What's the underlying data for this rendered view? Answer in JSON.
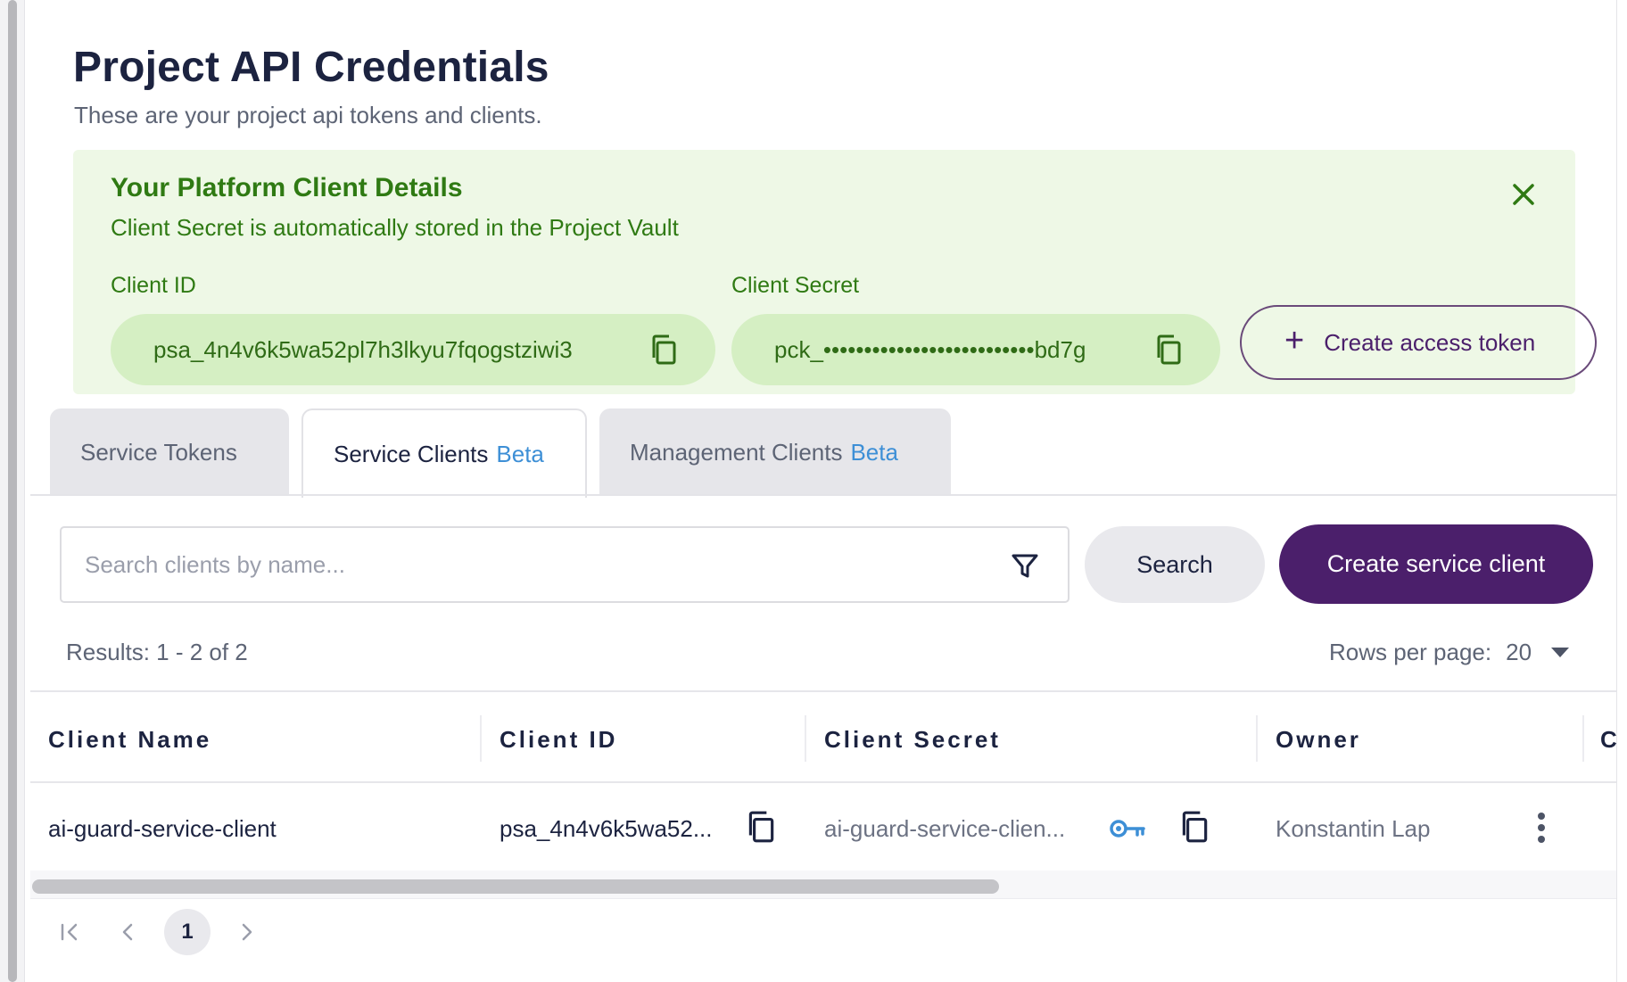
{
  "page": {
    "title": "Project API Credentials",
    "subtitle": "These are your project api tokens and clients."
  },
  "banner": {
    "title": "Your Platform Client Details",
    "subtitle": "Client Secret is automatically stored in the Project Vault",
    "client_id_label": "Client ID",
    "client_id_value": "psa_4n4v6k5wa52pl7h3lkyu7fqogstziwi3",
    "client_secret_label": "Client Secret",
    "client_secret_value": "pck_••••••••••••••••••••••••••bd7g",
    "create_token_label": "Create access token",
    "accent_color": "#2f7a13",
    "background_color": "#eef8e6"
  },
  "tabs": [
    {
      "label": "Service Tokens",
      "badge": ""
    },
    {
      "label": "Service Clients",
      "badge": "Beta"
    },
    {
      "label": "Management Clients",
      "badge": "Beta"
    }
  ],
  "active_tab": "Service Clients",
  "toolbar": {
    "search_placeholder": "Search clients by name...",
    "search_value": "",
    "search_button": "Search",
    "create_button": "Create service client",
    "primary_color": "#4b1f6b"
  },
  "results": {
    "summary": "Results: 1 - 2 of 2",
    "rows_per_page_label": "Rows per page:",
    "rows_per_page_value": "20"
  },
  "table": {
    "columns": [
      "Client Name",
      "Client ID",
      "Client Secret",
      "Owner",
      "Cr"
    ],
    "rows": [
      {
        "client_name": "ai-guard-service-client",
        "client_id": "psa_4n4v6k5wa52...",
        "client_secret": "ai-guard-service-clien...",
        "owner": "Konstantin Lap"
      }
    ]
  },
  "pagination": {
    "first": "first-page-icon",
    "prev": "prev-page-icon",
    "current": "1",
    "next": "next-page-icon"
  }
}
